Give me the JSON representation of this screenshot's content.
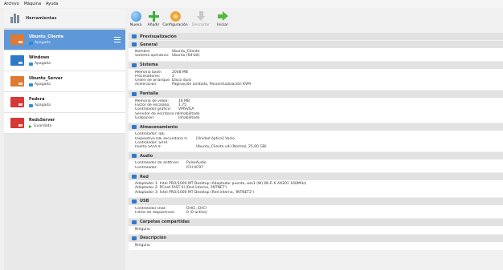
{
  "menubar": [
    "Archivo",
    "Máquina",
    "Ayuda"
  ],
  "sidebar": {
    "tools_label": "Herramientas",
    "vms": [
      {
        "name": "Ubuntu_Cliente",
        "state": "Apagada",
        "state_kind": "off",
        "selected": true,
        "color": "#e07a32"
      },
      {
        "name": "Windows",
        "state": "Apagada",
        "state_kind": "off",
        "selected": false,
        "color": "#2f79c9"
      },
      {
        "name": "Ubuntu_Server",
        "state": "Apagada",
        "state_kind": "off",
        "selected": false,
        "color": "#dd7a34"
      },
      {
        "name": "Fedora",
        "state": "Apagada",
        "state_kind": "off",
        "selected": false,
        "color": "#d63838"
      },
      {
        "name": "RedsServer",
        "state": "Guardada",
        "state_kind": "saved",
        "selected": false,
        "color": "#d63838"
      }
    ]
  },
  "toolbar": {
    "new": "Nueva",
    "add": "Añadir",
    "config": "Configuración",
    "discard": "Descartar",
    "start": "Iniciar"
  },
  "details": {
    "preview": {
      "title": "Previsualización"
    },
    "general": {
      "title": "General",
      "rows": [
        {
          "k": "Nombre:",
          "v": "Ubuntu_Cliente"
        },
        {
          "k": "Sistema operativo:",
          "v": "Ubuntu (64-bit)"
        }
      ]
    },
    "system": {
      "title": "Sistema",
      "rows": [
        {
          "k": "Memoria base:",
          "v": "2048 MB"
        },
        {
          "k": "Procesadores:",
          "v": "2"
        },
        {
          "k": "Orden de arranque:",
          "v": "Disco duro"
        },
        {
          "k": "Aceleración:",
          "v": "Paginación anidada, Paravirtualización KVM"
        }
      ]
    },
    "display": {
      "title": "Pantalla",
      "rows": [
        {
          "k": "Memoria de vídeo:",
          "v": "16 MB"
        },
        {
          "k": "Factor de escalado:",
          "v": "1.75"
        },
        {
          "k": "Controlador gráfico:",
          "v": "VMSVGA"
        },
        {
          "k": "Servidor de escritorio remoto:",
          "v": "Inhabilitado"
        },
        {
          "k": "Grabación:",
          "v": "Inhabilitado"
        }
      ]
    },
    "storage": {
      "title": "Almacenamiento",
      "rows": [
        {
          "k": "Controlador: IDE",
          "v": ""
        },
        {
          "k": "  Dispositivo IDE secundario 0:",
          "v": "[Unidad óptica] Vacío"
        },
        {
          "k": "Controlador: SATA",
          "v": ""
        },
        {
          "k": "  Puerto SATA 0:",
          "v": "Ubuntu_Cliente.vdi (Normal, 25,00 GB)"
        }
      ]
    },
    "audio": {
      "title": "Audio",
      "rows": [
        {
          "k": "Controlador de anfitrión:",
          "v": "PulseAudio"
        },
        {
          "k": "Controlador:",
          "v": "ICH AC97"
        }
      ]
    },
    "network": {
      "title": "Red",
      "lines": [
        "Adaptador 1:   Intel PRO/1000 MT Desktop (Adaptador puente, wlo1 (W) Wi-Fi 6 AX201 160MHz)",
        "Adaptador 2:   PCnet-FAST III (Red interna, 'INTNET')",
        "Adaptador 3:   Intel PRO/1000 MT Desktop (Red interna, 'INTNET2')"
      ]
    },
    "usb": {
      "title": "USB",
      "rows": [
        {
          "k": "Controlador USB:",
          "v": "OHCI, EHCI"
        },
        {
          "k": "Filtros de dispositivos:",
          "v": "0 (0 activo)"
        }
      ]
    },
    "shared": {
      "title": "Carpetas compartidas",
      "body": "Ninguno"
    },
    "description": {
      "title": "Descripción",
      "body": "Ninguno"
    }
  },
  "colors": {
    "selected": "#5e98d8",
    "section_header": "#e2e2e2",
    "icon_blue": "#2f79c9"
  }
}
